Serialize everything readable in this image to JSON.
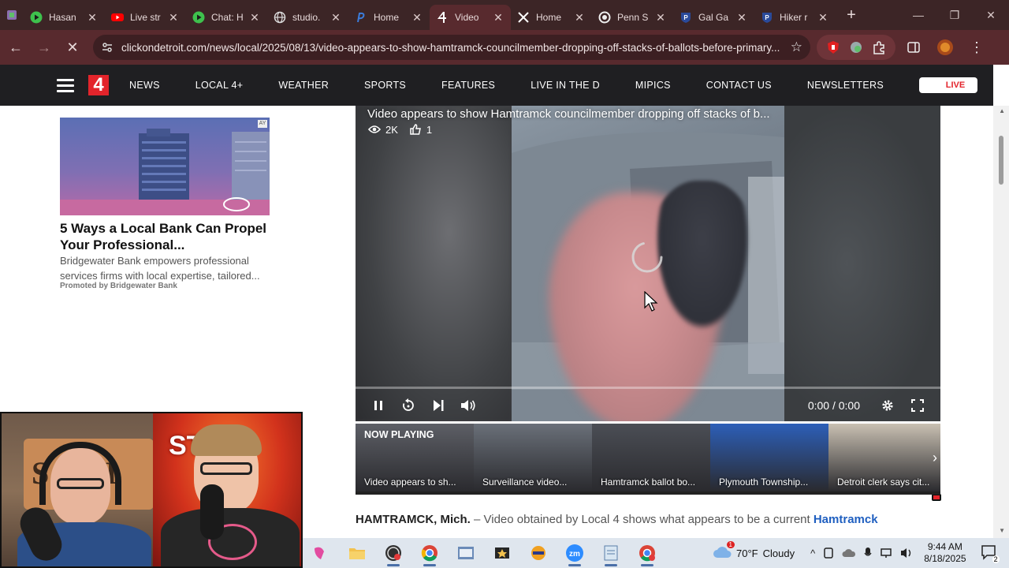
{
  "browser": {
    "tabs": [
      {
        "title": "Hasan",
        "icon": "play-icon"
      },
      {
        "title": "Live str",
        "icon": "youtube-icon"
      },
      {
        "title": "Chat: H",
        "icon": "play-icon"
      },
      {
        "title": "studio.",
        "icon": "globe-icon"
      },
      {
        "title": "Home",
        "icon": "p-icon"
      },
      {
        "title": "Video",
        "icon": "local4-icon",
        "active": true
      },
      {
        "title": "Home",
        "icon": "x-icon"
      },
      {
        "title": "Penn S",
        "icon": "circle-icon"
      },
      {
        "title": "Gal Ga",
        "icon": "shield-icon"
      },
      {
        "title": "Hiker r",
        "icon": "shield-icon"
      }
    ],
    "new_tab_label": "+",
    "url": "clickondetroit.com/news/local/2025/08/13/video-appears-to-show-hamtramck-councilmember-dropping-off-stacks-of-ballots-before-primary..."
  },
  "site": {
    "logo": "4",
    "nav": [
      "NEWS",
      "LOCAL 4+",
      "WEATHER",
      "SPORTS",
      "FEATURES",
      "LIVE IN THE D",
      "MIPICS",
      "CONTACT US",
      "NEWSLETTERS"
    ],
    "live_label": "LIVE"
  },
  "ad": {
    "title": "5 Ways a Local Bank Can Propel Your Professional...",
    "description": "Bridgewater Bank empowers professional services firms with local expertise, tailored...",
    "promoted": "Promoted by Bridgewater Bank"
  },
  "player": {
    "title": "Video appears to show Hamtramck councilmember dropping off stacks of b...",
    "views": "2K",
    "likes": "1",
    "timecode": "0:00 / 0:00",
    "progress": 0
  },
  "playlist": {
    "now_playing_label": "NOW PLAYING",
    "items": [
      {
        "caption": "Video appears to sh...",
        "color": "#5d5f66"
      },
      {
        "caption": "Surveillance video...",
        "color": "#6a7079"
      },
      {
        "caption": "Hamtramck ballot bo...",
        "color": "#4b4e55"
      },
      {
        "caption": "Plymouth Township...",
        "color": "#2d5fb8"
      },
      {
        "caption": "Detroit clerk says cit...",
        "color": "#c9c0b2"
      }
    ]
  },
  "article": {
    "location": "HAMTRAMCK, Mich.",
    "text": " – Video obtained by Local 4 shows what appears to be a current ",
    "link": "Hamtramck"
  },
  "webcam": {
    "sign_letters_left": "S FE I",
    "sign_letters_right": "ST  OE"
  },
  "taskbar": {
    "weather_temp": "70°F",
    "weather_desc": "Cloudy",
    "weather_badge": "1",
    "time": "9:44 AM",
    "date": "8/18/2025",
    "notification_count": "2"
  },
  "colors": {
    "tabbar": "#3c2526",
    "toolbar": "#582a2e",
    "site_nav": "#1f1f22",
    "brand_red": "#e3242b",
    "link_blue": "#1f5fc0"
  }
}
